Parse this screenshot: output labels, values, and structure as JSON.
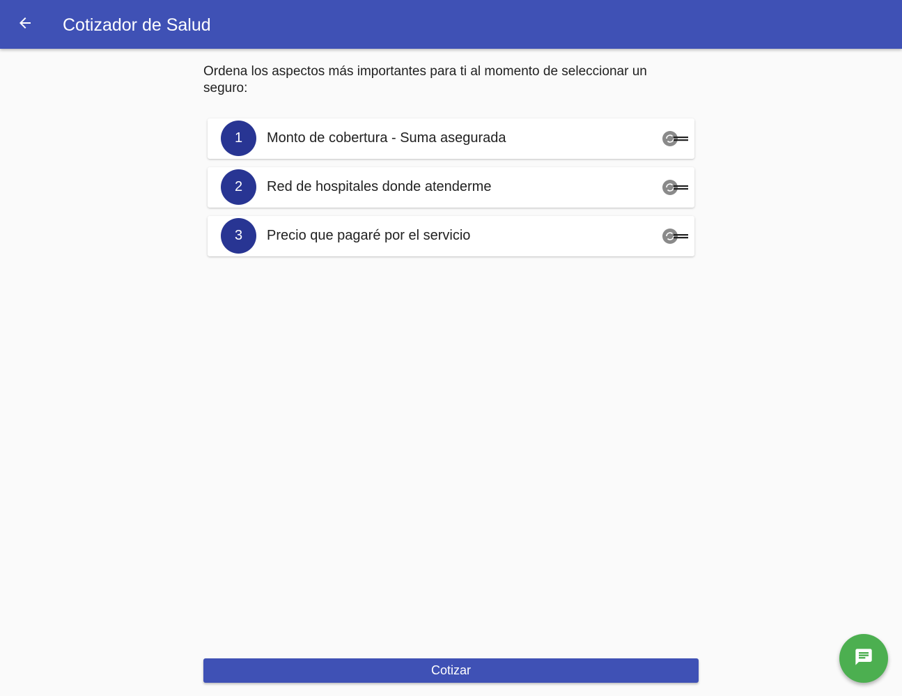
{
  "appbar": {
    "title": "Cotizador de Salud",
    "back_icon": "arrow-left-icon",
    "color": "#3f51b5"
  },
  "main": {
    "prompt": "Ordena los aspectos más importantes para ti al momento de seleccionar un seguro:",
    "items": [
      {
        "rank": "1",
        "label": "Monto de cobertura - Suma asegurada"
      },
      {
        "rank": "2",
        "label": "Red de hospitales donde atenderme"
      },
      {
        "rank": "3",
        "label": "Precio que pagaré por el servicio"
      }
    ],
    "rank_color": "#283593",
    "handle_icon": "drag-handle-icon"
  },
  "footer": {
    "submit_label": "Cotizar"
  },
  "fab": {
    "icon": "chat-icon",
    "color": "#4caf50"
  }
}
